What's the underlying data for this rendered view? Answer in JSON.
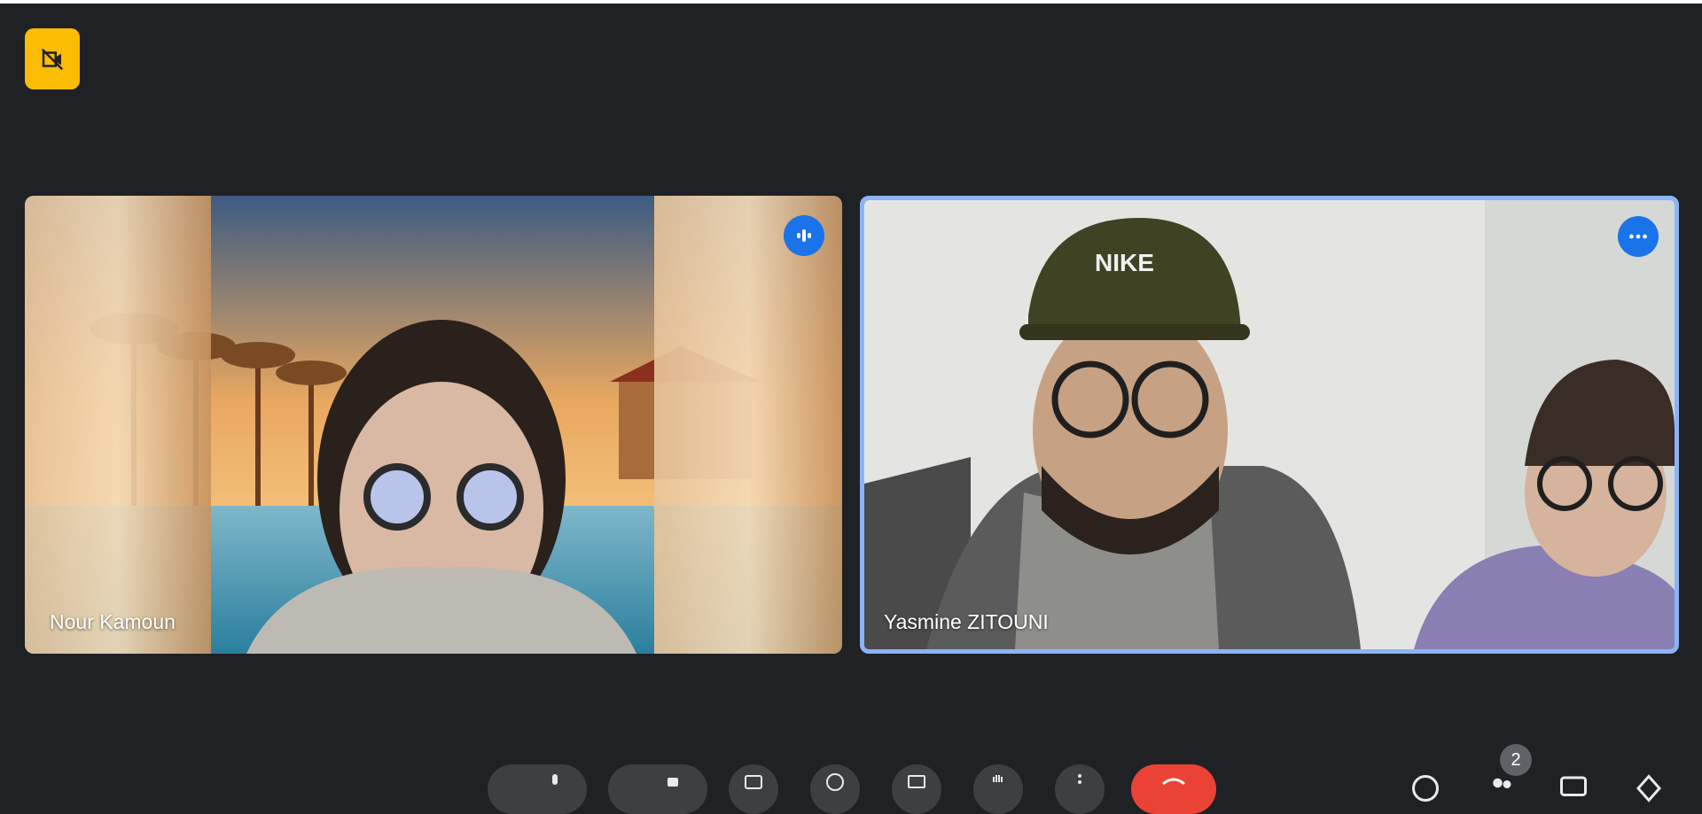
{
  "participants": [
    {
      "name": "Nour Kamoun",
      "status_icon": "audio-level-icon"
    },
    {
      "name": "Yasmine ZITOUNI",
      "status_icon": "more-options-icon",
      "active_speaker": true
    }
  ],
  "badges": {
    "recording_icon": "no-recording-icon",
    "participant_count": "2"
  },
  "colors": {
    "background": "#202124",
    "accent": "#1a73e8",
    "active_border": "#8ab4f8",
    "recording_badge": "#fbbc04",
    "end_call": "#ea4335"
  },
  "toolbar": {
    "buttons": [
      "microphone-icon",
      "camera-icon",
      "captions-icon",
      "emoji-icon",
      "present-icon",
      "raise-hand-icon",
      "more-options-icon",
      "end-call-icon",
      "info-icon",
      "people-icon",
      "chat-icon",
      "activities-icon"
    ]
  }
}
